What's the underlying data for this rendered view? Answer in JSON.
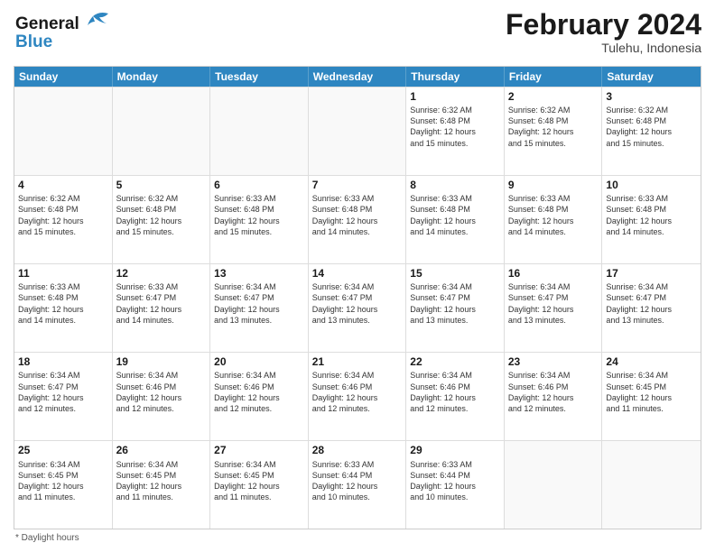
{
  "header": {
    "logo_line1": "General",
    "logo_line2": "Blue",
    "title": "February 2024",
    "subtitle": "Tulehu, Indonesia"
  },
  "days_of_week": [
    "Sunday",
    "Monday",
    "Tuesday",
    "Wednesday",
    "Thursday",
    "Friday",
    "Saturday"
  ],
  "footer": "* Daylight hours",
  "weeks": [
    [
      {
        "day": "",
        "info": ""
      },
      {
        "day": "",
        "info": ""
      },
      {
        "day": "",
        "info": ""
      },
      {
        "day": "",
        "info": ""
      },
      {
        "day": "1",
        "info": "Sunrise: 6:32 AM\nSunset: 6:48 PM\nDaylight: 12 hours\nand 15 minutes."
      },
      {
        "day": "2",
        "info": "Sunrise: 6:32 AM\nSunset: 6:48 PM\nDaylight: 12 hours\nand 15 minutes."
      },
      {
        "day": "3",
        "info": "Sunrise: 6:32 AM\nSunset: 6:48 PM\nDaylight: 12 hours\nand 15 minutes."
      }
    ],
    [
      {
        "day": "4",
        "info": "Sunrise: 6:32 AM\nSunset: 6:48 PM\nDaylight: 12 hours\nand 15 minutes."
      },
      {
        "day": "5",
        "info": "Sunrise: 6:32 AM\nSunset: 6:48 PM\nDaylight: 12 hours\nand 15 minutes."
      },
      {
        "day": "6",
        "info": "Sunrise: 6:33 AM\nSunset: 6:48 PM\nDaylight: 12 hours\nand 15 minutes."
      },
      {
        "day": "7",
        "info": "Sunrise: 6:33 AM\nSunset: 6:48 PM\nDaylight: 12 hours\nand 14 minutes."
      },
      {
        "day": "8",
        "info": "Sunrise: 6:33 AM\nSunset: 6:48 PM\nDaylight: 12 hours\nand 14 minutes."
      },
      {
        "day": "9",
        "info": "Sunrise: 6:33 AM\nSunset: 6:48 PM\nDaylight: 12 hours\nand 14 minutes."
      },
      {
        "day": "10",
        "info": "Sunrise: 6:33 AM\nSunset: 6:48 PM\nDaylight: 12 hours\nand 14 minutes."
      }
    ],
    [
      {
        "day": "11",
        "info": "Sunrise: 6:33 AM\nSunset: 6:48 PM\nDaylight: 12 hours\nand 14 minutes."
      },
      {
        "day": "12",
        "info": "Sunrise: 6:33 AM\nSunset: 6:47 PM\nDaylight: 12 hours\nand 14 minutes."
      },
      {
        "day": "13",
        "info": "Sunrise: 6:34 AM\nSunset: 6:47 PM\nDaylight: 12 hours\nand 13 minutes."
      },
      {
        "day": "14",
        "info": "Sunrise: 6:34 AM\nSunset: 6:47 PM\nDaylight: 12 hours\nand 13 minutes."
      },
      {
        "day": "15",
        "info": "Sunrise: 6:34 AM\nSunset: 6:47 PM\nDaylight: 12 hours\nand 13 minutes."
      },
      {
        "day": "16",
        "info": "Sunrise: 6:34 AM\nSunset: 6:47 PM\nDaylight: 12 hours\nand 13 minutes."
      },
      {
        "day": "17",
        "info": "Sunrise: 6:34 AM\nSunset: 6:47 PM\nDaylight: 12 hours\nand 13 minutes."
      }
    ],
    [
      {
        "day": "18",
        "info": "Sunrise: 6:34 AM\nSunset: 6:47 PM\nDaylight: 12 hours\nand 12 minutes."
      },
      {
        "day": "19",
        "info": "Sunrise: 6:34 AM\nSunset: 6:46 PM\nDaylight: 12 hours\nand 12 minutes."
      },
      {
        "day": "20",
        "info": "Sunrise: 6:34 AM\nSunset: 6:46 PM\nDaylight: 12 hours\nand 12 minutes."
      },
      {
        "day": "21",
        "info": "Sunrise: 6:34 AM\nSunset: 6:46 PM\nDaylight: 12 hours\nand 12 minutes."
      },
      {
        "day": "22",
        "info": "Sunrise: 6:34 AM\nSunset: 6:46 PM\nDaylight: 12 hours\nand 12 minutes."
      },
      {
        "day": "23",
        "info": "Sunrise: 6:34 AM\nSunset: 6:46 PM\nDaylight: 12 hours\nand 12 minutes."
      },
      {
        "day": "24",
        "info": "Sunrise: 6:34 AM\nSunset: 6:45 PM\nDaylight: 12 hours\nand 11 minutes."
      }
    ],
    [
      {
        "day": "25",
        "info": "Sunrise: 6:34 AM\nSunset: 6:45 PM\nDaylight: 12 hours\nand 11 minutes."
      },
      {
        "day": "26",
        "info": "Sunrise: 6:34 AM\nSunset: 6:45 PM\nDaylight: 12 hours\nand 11 minutes."
      },
      {
        "day": "27",
        "info": "Sunrise: 6:34 AM\nSunset: 6:45 PM\nDaylight: 12 hours\nand 11 minutes."
      },
      {
        "day": "28",
        "info": "Sunrise: 6:33 AM\nSunset: 6:44 PM\nDaylight: 12 hours\nand 10 minutes."
      },
      {
        "day": "29",
        "info": "Sunrise: 6:33 AM\nSunset: 6:44 PM\nDaylight: 12 hours\nand 10 minutes."
      },
      {
        "day": "",
        "info": ""
      },
      {
        "day": "",
        "info": ""
      }
    ]
  ]
}
